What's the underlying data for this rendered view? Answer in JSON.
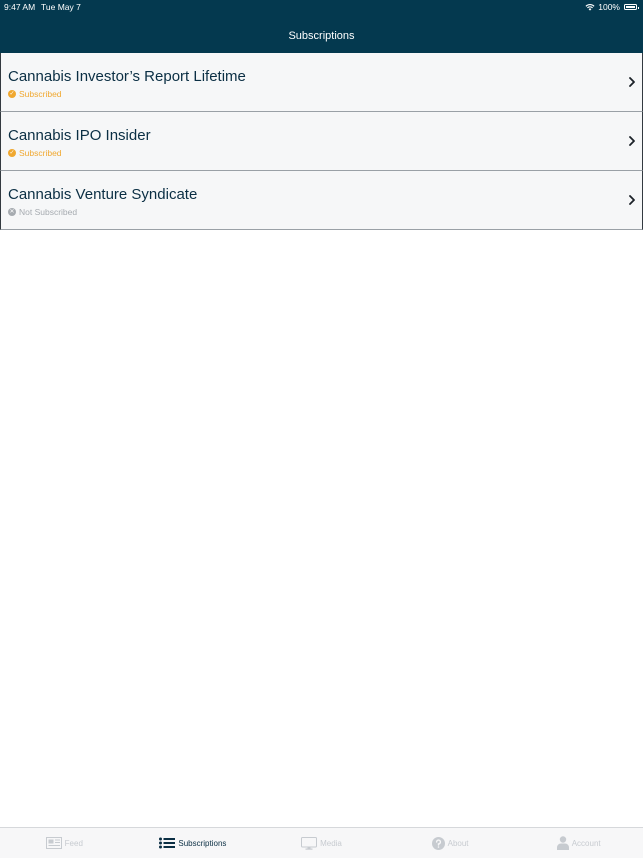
{
  "status_bar": {
    "time": "9:47 AM",
    "date": "Tue May 7",
    "battery": "100%"
  },
  "nav": {
    "title": "Subscriptions"
  },
  "subscriptions": [
    {
      "title": "Cannabis Investor’s Report Lifetime",
      "status": "Subscribed",
      "subscribed": true
    },
    {
      "title": "Cannabis IPO Insider",
      "status": "Subscribed",
      "subscribed": true
    },
    {
      "title": "Cannabis Venture Syndicate",
      "status": "Not Subscribed",
      "subscribed": false
    }
  ],
  "tabs": [
    {
      "label": "Feed",
      "icon": "newspaper-icon",
      "active": false
    },
    {
      "label": "Subscriptions",
      "icon": "list-icon",
      "active": true
    },
    {
      "label": "Media",
      "icon": "monitor-icon",
      "active": false
    },
    {
      "label": "About",
      "icon": "question-icon",
      "active": false
    },
    {
      "label": "Account",
      "icon": "user-icon",
      "active": false
    }
  ],
  "colors": {
    "header_bg": "#04394f",
    "subscribed": "#f0a830",
    "not_subscribed": "#a6abb0",
    "active_tab": "#0b2f44",
    "inactive_tab": "#c7cbd0"
  }
}
